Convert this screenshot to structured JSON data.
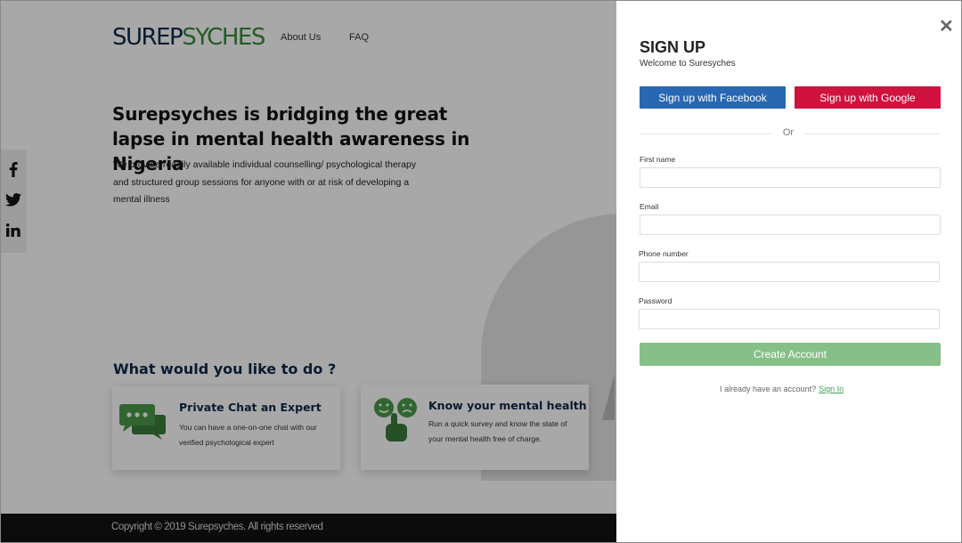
{
  "header": {
    "logo_part1": "SUREP",
    "logo_part2": "SYCHES",
    "nav": [
      "About Us",
      "FAQ"
    ]
  },
  "social_icons": [
    "facebook-icon",
    "twitter-icon",
    "linkedin-icon"
  ],
  "hero": {
    "title": "Surepsyches is bridging the great lapse in mental health awareness in Nigeria",
    "description": "We provide readily available individual counselling/ psychological therapy and structured group sessions for anyone with or at risk of developing a mental illness"
  },
  "services": {
    "section_title": "What would you like to do ?",
    "cards": [
      {
        "icon": "chat-bubbles-icon",
        "title": "Private Chat an Expert",
        "text": "You can have a one-on-one chat with our verified psychological expert"
      },
      {
        "icon": "mood-survey-icon",
        "title": "Know your mental health",
        "text": "Run a quick survey and know the state of your mental health free of charge."
      }
    ]
  },
  "footer": {
    "copyright": "Copyright © 2019 Surepsyches. All rights reserved"
  },
  "signup": {
    "close_icon": "close-icon",
    "title": "SIGN UP",
    "subtitle": "Welcome to Suresyches",
    "facebook_button": "Sign up with Facebook",
    "google_button": "Sign up with Google",
    "divider_text": "Or",
    "fields": {
      "first_name": {
        "label": "First name",
        "value": ""
      },
      "email": {
        "label": "Email",
        "value": ""
      },
      "phone": {
        "label": "Phone number",
        "value": ""
      },
      "password": {
        "label": "Password",
        "value": ""
      }
    },
    "submit_button": "Create Account",
    "have_account_text": "I already have an account?",
    "signin_link": "Sign In"
  },
  "colors": {
    "brand_dark": "#0f2a4a",
    "brand_green": "#3a8a3a",
    "facebook": "#2867b2",
    "google": "#d0123f",
    "create_button": "#86c088"
  }
}
